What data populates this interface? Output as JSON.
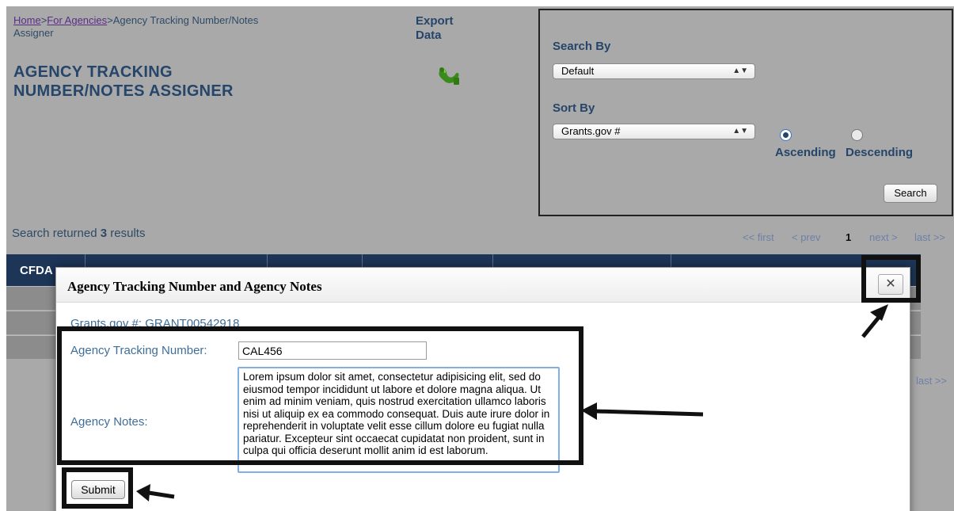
{
  "breadcrumb": {
    "home": "Home",
    "sep1": ">",
    "agencies": "For Agencies",
    "sep2": ">",
    "current_line1": "Agency Tracking Number/Notes",
    "current_line2": "Assigner"
  },
  "page": {
    "title_line1": "AGENCY TRACKING",
    "title_line2": "NUMBER/NOTES ASSIGNER"
  },
  "export": {
    "label_line1": "Export",
    "label_line2": "Data",
    "icon": "export-data-icon"
  },
  "search_panel": {
    "search_by_label": "Search By",
    "search_by_value": "Default",
    "sort_by_label": "Sort By",
    "sort_by_value": "Grants.gov #",
    "ascending_label": "Ascending",
    "descending_label": "Descending",
    "selected_order": "Ascending",
    "search_button": "Search"
  },
  "results": {
    "prefix": "Search returned",
    "count": "3",
    "suffix": "results"
  },
  "pagination": {
    "first": "<< first",
    "prev": "< prev",
    "current": "1",
    "next": "next >",
    "last": "last >>"
  },
  "table": {
    "first_header": "CFDA"
  },
  "modal": {
    "title": "Agency Tracking Number and Agency Notes",
    "close_label": "✕",
    "grants_number_label": "Grants.gov #:",
    "grants_number_value": "GRANT00542918",
    "tracking_label": "Agency Tracking Number:",
    "tracking_value": "CAL456",
    "notes_label": "Agency Notes:",
    "notes_value": "Lorem ipsum dolor sit amet, consectetur adipisicing elit, sed do eiusmod tempor incididunt ut labore et dolore magna aliqua. Ut enim ad minim veniam, quis nostrud exercitation ullamco laboris nisi ut aliquip ex ea commodo consequat. Duis aute irure dolor in reprehenderit in voluptate velit esse cillum dolore eu fugiat nulla pariatur. Excepteur sint occaecat cupidatat non proident, sunt in culpa qui officia deserunt mollit anim id est laborum.",
    "submit_label": "Submit"
  },
  "colors": {
    "navy": "#1d3557",
    "heading_blue": "#25456a",
    "link_purple": "#5a2d86",
    "overlay_gray": "#a9a9a9"
  }
}
